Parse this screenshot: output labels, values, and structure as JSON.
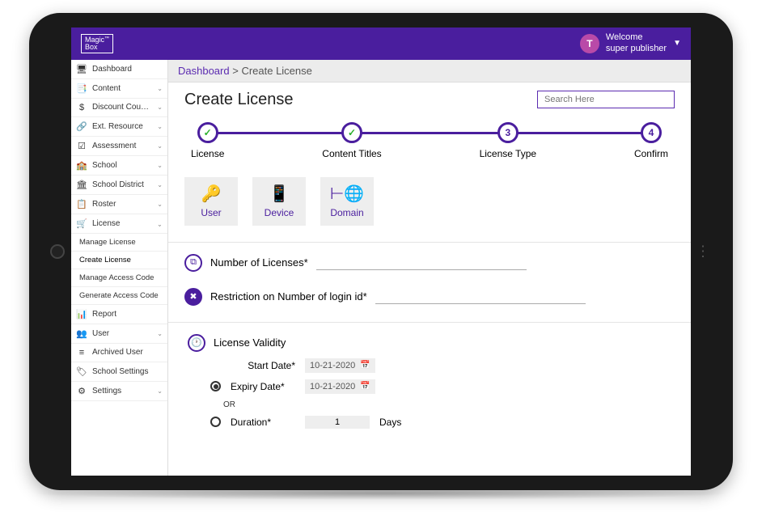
{
  "brand": {
    "line1": "Magic",
    "line2": "Box",
    "tm": "™"
  },
  "user": {
    "initial": "T",
    "welcome": "Welcome",
    "name": "super publisher"
  },
  "sidebar": {
    "items": [
      {
        "icon": "🖥",
        "label": "Dashboard",
        "expandable": false
      },
      {
        "icon": "📑",
        "label": "Content",
        "expandable": true
      },
      {
        "icon": "$",
        "label": "Discount Coupon",
        "expandable": true
      },
      {
        "icon": "🔗",
        "label": "Ext. Resource",
        "expandable": true
      },
      {
        "icon": "☑",
        "label": "Assessment",
        "expandable": true
      },
      {
        "icon": "🏫",
        "label": "School",
        "expandable": true
      },
      {
        "icon": "🏛",
        "label": "School District",
        "expandable": true
      },
      {
        "icon": "📋",
        "label": "Roster",
        "expandable": true
      },
      {
        "icon": "🛒",
        "label": "License",
        "expandable": true,
        "open": true
      },
      {
        "icon": "📊",
        "label": "Report",
        "expandable": false
      },
      {
        "icon": "👥",
        "label": "User",
        "expandable": true
      },
      {
        "icon": "≡",
        "label": "Archived User",
        "expandable": false
      },
      {
        "icon": "🏷",
        "label": "School Settings",
        "expandable": false
      },
      {
        "icon": "⚙",
        "label": "Settings",
        "expandable": true
      }
    ],
    "license_sub": [
      "Manage License",
      "Create License",
      "Manage Access Code",
      "Generate Access Code"
    ]
  },
  "breadcrumb": {
    "root": "Dashboard",
    "sep": " > ",
    "current": "Create License"
  },
  "page": {
    "title": "Create License",
    "search_placeholder": "Search Here"
  },
  "steps": [
    {
      "label": "License",
      "mark": "✓",
      "done": true
    },
    {
      "label": "Content Titles",
      "mark": "✓",
      "done": true
    },
    {
      "label": "License Type",
      "mark": "3",
      "done": false
    },
    {
      "label": "Confirm",
      "mark": "4",
      "done": false
    }
  ],
  "types": [
    {
      "icon": "🔑",
      "label": "User"
    },
    {
      "icon": "📱",
      "label": "Device"
    },
    {
      "icon": "⊢🌐",
      "label": "Domain"
    }
  ],
  "form": {
    "num_licenses_label": "Number of Licenses*",
    "restriction_label": "Restriction on Number of login id*",
    "validity_label": "License Validity",
    "start_date_label": "Start Date*",
    "start_date_value": "10-21-2020",
    "expiry_date_label": "Expiry Date*",
    "expiry_date_value": "10-21-2020",
    "or_label": "OR",
    "duration_label": "Duration*",
    "duration_value": "1",
    "duration_unit": "Days"
  }
}
